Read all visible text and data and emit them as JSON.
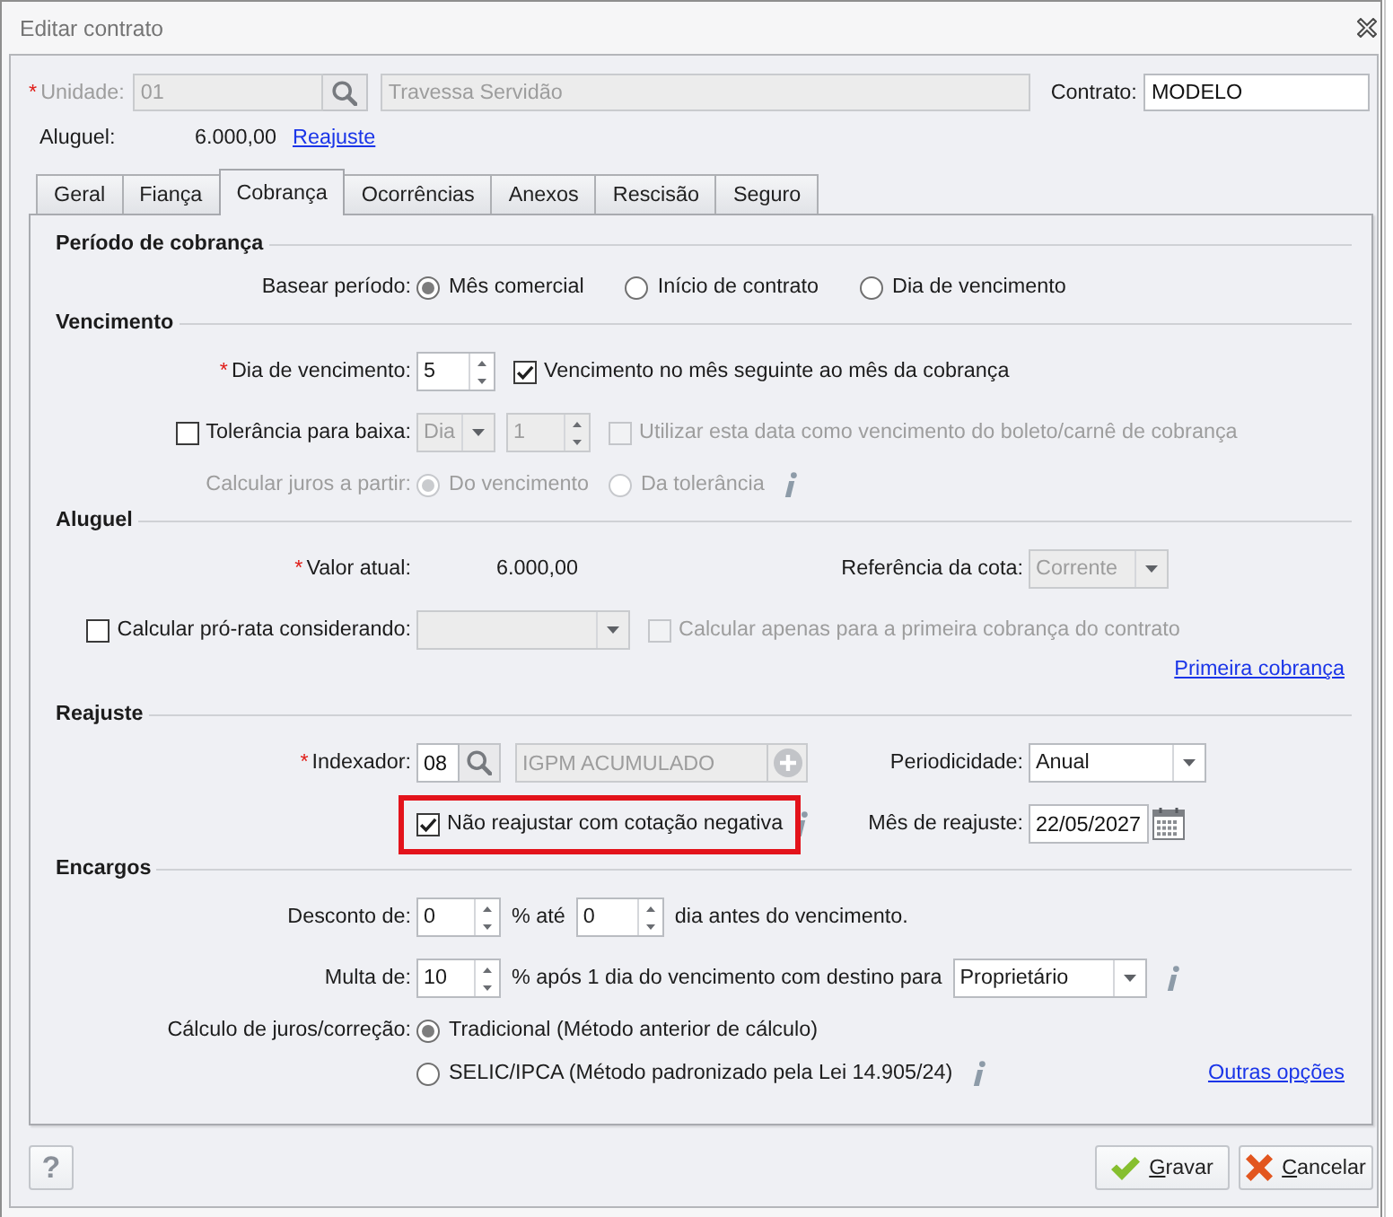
{
  "window": {
    "title": "Editar contrato"
  },
  "header": {
    "unidade": {
      "mark": "*",
      "label": "Unidade:",
      "code": "01",
      "description": "Travessa Servidão",
      "disabled": true
    },
    "contrato": {
      "label": "Contrato:",
      "value": "MODELO",
      "disabled": false
    },
    "aluguel": {
      "label": "Aluguel:",
      "value": "6.000,00",
      "link": "Reajuste"
    }
  },
  "tabs": [
    {
      "label": "Geral",
      "selected": false
    },
    {
      "label": "Fiança",
      "selected": false
    },
    {
      "label": "Cobrança",
      "selected": true
    },
    {
      "label": "Ocorrências",
      "selected": false
    },
    {
      "label": "Anexos",
      "selected": false
    },
    {
      "label": "Rescisão",
      "selected": false
    },
    {
      "label": "Seguro",
      "selected": false
    }
  ],
  "sections": [
    {
      "title": "Período de cobrança",
      "rows": [
        {
          "label": {
            "text": "Basear período:",
            "disabled": false
          },
          "controls": [
            {
              "kind": "radio",
              "label": "Mês comercial",
              "selected": true,
              "disabled": false
            },
            {
              "kind": "radio",
              "label": "Início de contrato",
              "selected": false,
              "disabled": false
            },
            {
              "kind": "radio",
              "label": "Dia de vencimento",
              "selected": false,
              "disabled": false
            }
          ]
        }
      ]
    },
    {
      "title": "Vencimento",
      "rows": [
        {
          "label": {
            "mark": "*",
            "text": "Dia de vencimento:",
            "disabled": false
          },
          "controls": [
            {
              "kind": "spinner",
              "value": "5",
              "disabled": false
            },
            {
              "kind": "checkbox",
              "label": "Vencimento no mês seguinte ao mês da cobrança",
              "checked": true,
              "disabled": false,
              "highlighted": false
            }
          ]
        },
        {
          "label": {
            "kind": "checkbox",
            "text": "Tolerância para baixa:",
            "checked": false,
            "disabled": false
          },
          "controls": [
            {
              "kind": "select",
              "value": "Dia",
              "disabled": true
            },
            {
              "kind": "spinner",
              "value": "1",
              "disabled": true
            },
            {
              "kind": "checkbox",
              "label": "Utilizar esta data como vencimento do boleto/carnê de cobrança",
              "checked": false,
              "disabled": true,
              "highlighted": false
            }
          ]
        },
        {
          "label": {
            "text": "Calcular juros a partir:",
            "disabled": true
          },
          "controls": [
            {
              "kind": "radio",
              "label": "Do vencimento",
              "selected": true,
              "disabled": true
            },
            {
              "kind": "radio",
              "label": "Da tolerância",
              "selected": false,
              "disabled": true
            },
            {
              "kind": "info"
            }
          ]
        }
      ]
    },
    {
      "title": "Aluguel",
      "rows": [
        {
          "label": {
            "mark": "*",
            "text": "Valor atual:",
            "disabled": false
          },
          "controls": [
            {
              "kind": "value",
              "value": "6.000,00"
            }
          ],
          "right": {
            "label": "Referência da cota:",
            "controls": [
              {
                "kind": "select",
                "value": "Corrente",
                "disabled": true
              }
            ]
          }
        },
        {
          "label": {
            "kind": "checkbox",
            "text": "Calcular pró-rata considerando:",
            "checked": false,
            "disabled": false
          },
          "controls": [
            {
              "kind": "select",
              "disabled": true
            },
            {
              "kind": "checkbox",
              "label": "Calcular apenas para a primeira cobrança do contrato",
              "checked": false,
              "disabled": true,
              "highlighted": false
            }
          ]
        },
        {
          "controls": [
            {
              "kind": "link",
              "label": "Primeira cobrança"
            }
          ]
        }
      ]
    },
    {
      "title": "Reajuste",
      "rows": [
        {
          "label": {
            "mark": "*",
            "text": "Indexador:",
            "disabled": false
          },
          "controls": [
            {
              "kind": "lookup",
              "value": "08",
              "disabled": false
            },
            {
              "kind": "input",
              "value": "IGPM ACUMULADO",
              "disabled": true
            },
            {
              "kind": "add",
              "disabled": true
            }
          ],
          "right": {
            "label": "Periodicidade:",
            "controls": [
              {
                "kind": "select",
                "value": "Anual",
                "disabled": false
              }
            ]
          }
        },
        {
          "controls": [
            {
              "kind": "checkbox",
              "label": "Não reajustar com cotação negativa",
              "checked": true,
              "disabled": false,
              "highlighted": true
            },
            {
              "kind": "info"
            }
          ],
          "right": {
            "label": "Mês de reajuste:",
            "controls": [
              {
                "kind": "date",
                "value": "22/05/2027",
                "disabled": false
              }
            ]
          }
        }
      ]
    },
    {
      "title": "Encargos",
      "rows": [
        {
          "label": {
            "text": "Desconto de:",
            "disabled": false
          },
          "controls": [
            {
              "kind": "spinner",
              "value": "0",
              "disabled": false
            },
            {
              "kind": "text",
              "label": "% até"
            },
            {
              "kind": "spinner",
              "value": "0",
              "disabled": false
            },
            {
              "kind": "text",
              "label": "dia antes do vencimento."
            }
          ]
        },
        {
          "label": {
            "text": "Multa de:",
            "disabled": false
          },
          "controls": [
            {
              "kind": "spinner",
              "value": "10",
              "disabled": false
            },
            {
              "kind": "text",
              "label": "% após 1 dia do vencimento com destino para"
            },
            {
              "kind": "select",
              "value": "Proprietário",
              "disabled": false
            },
            {
              "kind": "info"
            }
          ]
        },
        {
          "label": {
            "text": "Cálculo de juros/correção:",
            "disabled": false
          },
          "controls": [
            {
              "kind": "radio",
              "label": "Tradicional (Método anterior de cálculo)",
              "selected": true,
              "disabled": false
            }
          ]
        },
        {
          "controls": [
            {
              "kind": "radio",
              "label": "SELIC/IPCA (Método padronizado pela Lei 14.905/24)",
              "selected": false,
              "disabled": false
            },
            {
              "kind": "info"
            },
            {
              "kind": "link",
              "label": "Outras opções"
            }
          ]
        }
      ]
    }
  ],
  "footer": {
    "help": "?",
    "buttons": [
      {
        "kind": "save",
        "label": "Gravar",
        "mnemonic": true
      },
      {
        "kind": "cancel",
        "label": "Cancelar",
        "mnemonic": true
      }
    ]
  }
}
